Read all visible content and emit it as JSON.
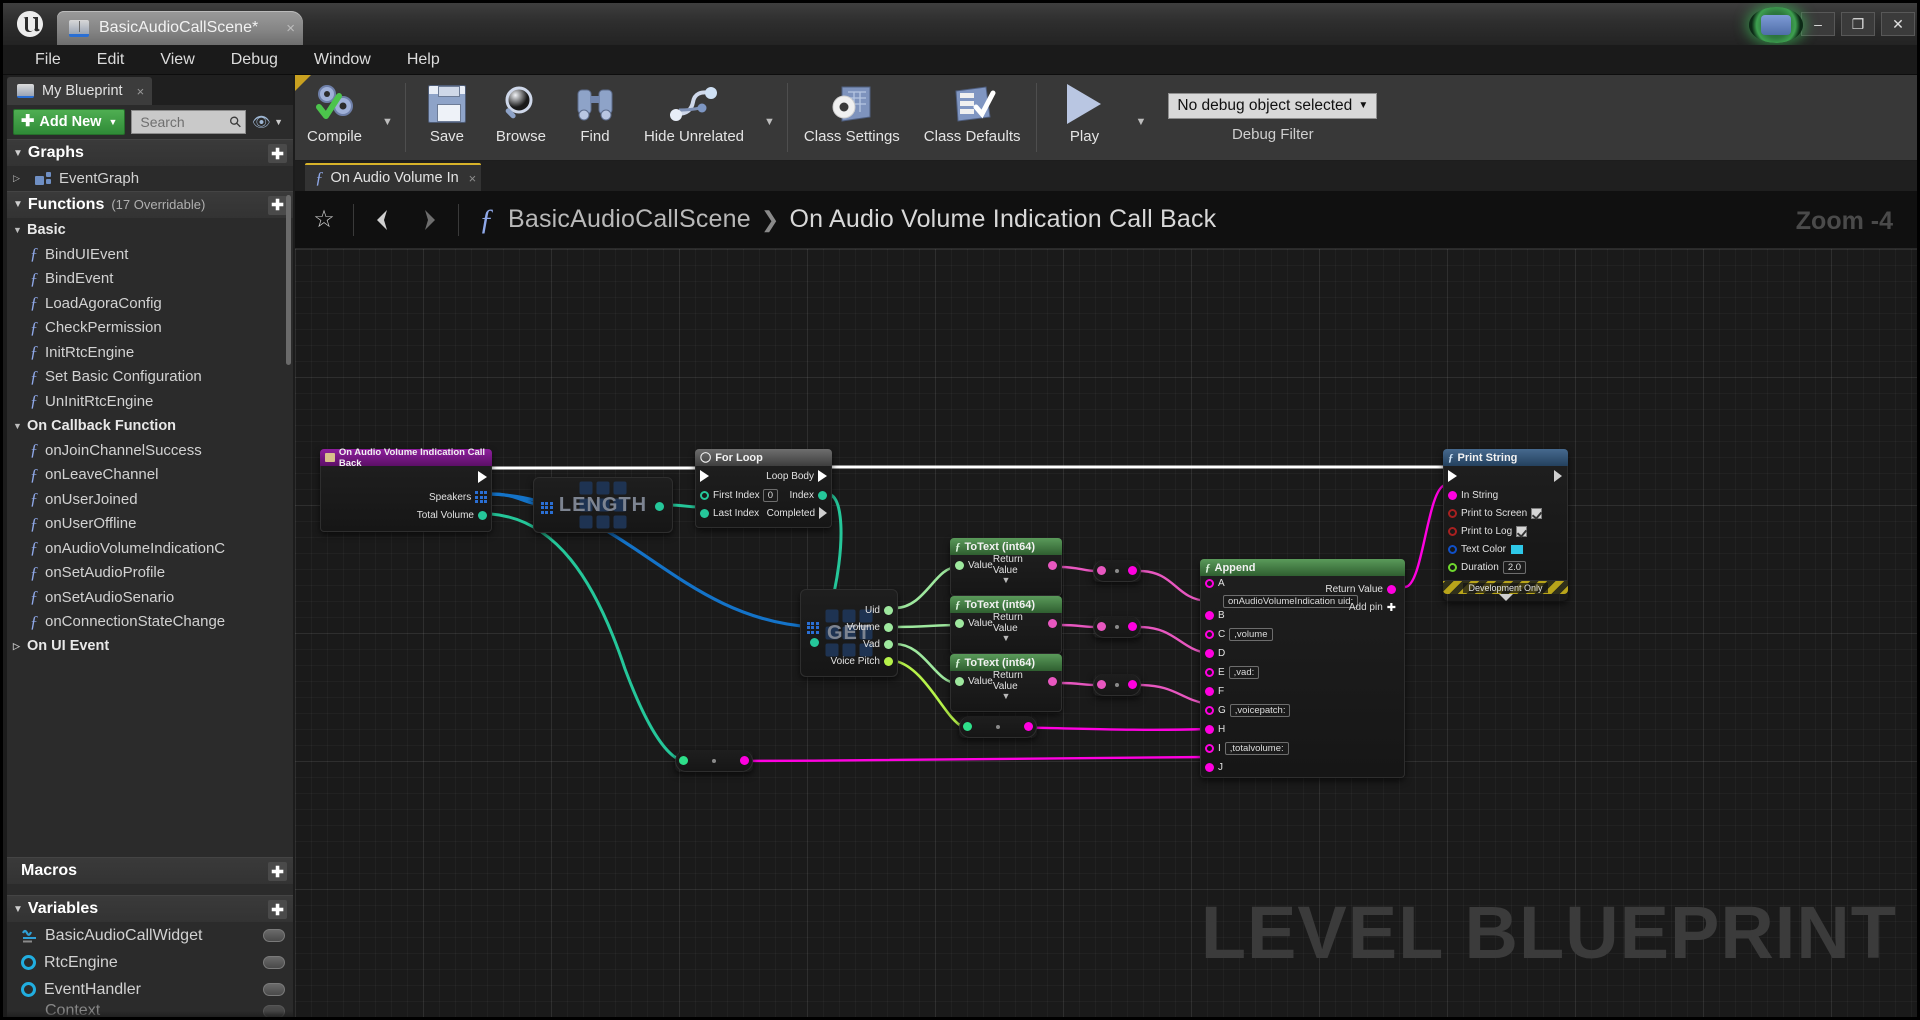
{
  "window": {
    "app_title": "BasicAudioCallScene*",
    "tab_close": "×",
    "minimize": "–",
    "maximize": "❐",
    "close": "✕"
  },
  "menubar": {
    "items": [
      "File",
      "Edit",
      "View",
      "Debug",
      "Window",
      "Help"
    ]
  },
  "myblueprint": {
    "tab_label": "My Blueprint",
    "tab_close": "×",
    "add_new_label": "Add New",
    "search_placeholder": "Search",
    "sections": {
      "graphs": {
        "label": "Graphs",
        "items": [
          "EventGraph"
        ]
      },
      "functions": {
        "label": "Functions",
        "sublabel": "(17 Overridable)"
      },
      "basic": {
        "label": "Basic",
        "items": [
          "BindUIEvent",
          "BindEvent",
          "LoadAgoraConfig",
          "CheckPermission",
          "InitRtcEngine",
          "Set Basic Configuration",
          "UnInitRtcEngine"
        ]
      },
      "on_callback_function": {
        "label": "On Callback Function",
        "items": [
          "onJoinChannelSuccess",
          "onLeaveChannel",
          "onUserJoined",
          "onUserOffline",
          "onAudioVolumeIndicationC",
          "onSetAudioProfile",
          "onSetAudioSenario",
          "onConnectionStateChange"
        ]
      },
      "on_ui_event": {
        "label": "On UI Event"
      },
      "macros": {
        "label": "Macros"
      },
      "variables": {
        "label": "Variables",
        "items": [
          {
            "name": "BasicAudioCallWidget",
            "kind": "widget"
          },
          {
            "name": "RtcEngine",
            "kind": "object"
          },
          {
            "name": "EventHandler",
            "kind": "object"
          },
          {
            "name": "Context",
            "kind": "widget"
          }
        ]
      }
    }
  },
  "toolbar": {
    "compile": "Compile",
    "save": "Save",
    "browse": "Browse",
    "find": "Find",
    "hide_unrelated": "Hide Unrelated",
    "class_settings": "Class Settings",
    "class_defaults": "Class Defaults",
    "play": "Play",
    "debug_object": "No debug object selected",
    "debug_filter": "Debug Filter"
  },
  "graph_tab": {
    "label": "On Audio Volume In",
    "close": "×"
  },
  "breadcrumb": {
    "root": "BasicAudioCallScene",
    "separator": "❯",
    "current": "On Audio Volume Indication Call Back",
    "zoom": "Zoom -4",
    "star_icon": "☆"
  },
  "canvas": {
    "watermark": "LEVEL BLUEPRINT"
  },
  "nodes": {
    "event": {
      "title": "On Audio Volume Indication Call Back",
      "pins": [
        "Speakers",
        "Total Volume"
      ]
    },
    "length": {
      "ghost": "LENGTH"
    },
    "forloop": {
      "title": "For Loop",
      "in_pins": [
        "First Index",
        "Last Index"
      ],
      "first_index_value": "0",
      "out_pins": [
        "Loop Body",
        "Index",
        "Completed"
      ]
    },
    "get": {
      "ghost": "GET",
      "out_pins": [
        "Uid",
        "Volume",
        "Vad",
        "Voice Pitch"
      ]
    },
    "totext": [
      {
        "title": "ToText (int64)",
        "in": "Value",
        "out": "Return Value"
      },
      {
        "title": "ToText (int64)",
        "in": "Value",
        "out": "Return Value"
      },
      {
        "title": "ToText (int64)",
        "in": "Value",
        "out": "Return Value"
      }
    ],
    "append": {
      "title": "Append",
      "return_label": "Return Value",
      "add_pin_label": "Add pin",
      "pins": [
        {
          "letter": "A",
          "value": "onAudioVolumeIndication uid:"
        },
        {
          "letter": "B",
          "value": ""
        },
        {
          "letter": "C",
          "value": ",volume"
        },
        {
          "letter": "D",
          "value": ""
        },
        {
          "letter": "E",
          "value": ",vad:"
        },
        {
          "letter": "F",
          "value": ""
        },
        {
          "letter": "G",
          "value": ",voicepatch:"
        },
        {
          "letter": "H",
          "value": ""
        },
        {
          "letter": "I",
          "value": ",totalvolume:"
        },
        {
          "letter": "J",
          "value": ""
        }
      ]
    },
    "printstring": {
      "title": "Print String",
      "in_string": "In String",
      "print_to_screen": "Print to Screen",
      "print_to_log": "Print to Log",
      "text_color": "Text Color",
      "duration": "Duration",
      "duration_value": "2.0",
      "footer": "Development Only",
      "text_color_swatch": "#2ec8e8"
    }
  },
  "colors": {
    "exec_white": "#ffffff",
    "struct_blue": "#1473c8",
    "float_green": "#3ddc9a",
    "string_magenta": "#ff00e0",
    "text_pink": "#e857c0",
    "int_green": "#8ce08c",
    "bool_red": "#a82020",
    "linear_blue": "#1050c8",
    "accent_yellow": "#d8b32a",
    "add_new_green": "#3f9c46"
  }
}
